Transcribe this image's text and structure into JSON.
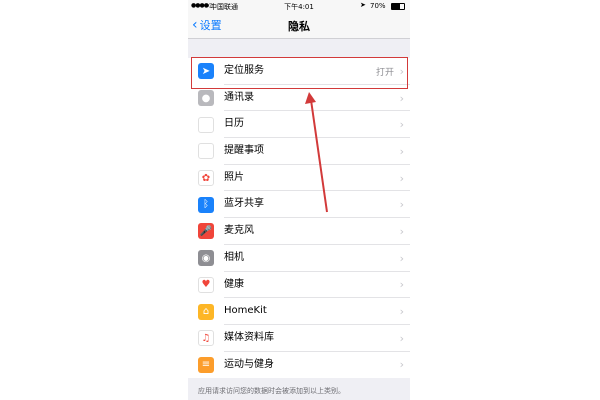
{
  "status_bar": {
    "carrier": "中国联通",
    "time": "下午4:01",
    "battery": "70%"
  },
  "nav": {
    "back_label": "设置",
    "title": "隐私"
  },
  "items": [
    {
      "label": "定位服务",
      "value": "打开",
      "icon": "location-icon",
      "color": "#1a82fb",
      "glyph": "➤"
    },
    {
      "label": "通讯录",
      "value": "",
      "icon": "contacts-icon",
      "color": "#b9b9bd",
      "glyph": "●"
    },
    {
      "label": "日历",
      "value": "",
      "icon": "calendar-icon",
      "color": "#ffffff",
      "glyph": ""
    },
    {
      "label": "提醒事项",
      "value": "",
      "icon": "reminders-icon",
      "color": "#ffffff",
      "glyph": ""
    },
    {
      "label": "照片",
      "value": "",
      "icon": "photos-icon",
      "color": "#ffffff",
      "glyph": "✿"
    },
    {
      "label": "蓝牙共享",
      "value": "",
      "icon": "bluetooth-icon",
      "color": "#1a82fb",
      "glyph": "ᛒ"
    },
    {
      "label": "麦克风",
      "value": "",
      "icon": "microphone-icon",
      "color": "#f0453a",
      "glyph": "🎤"
    },
    {
      "label": "相机",
      "value": "",
      "icon": "camera-icon",
      "color": "#8e8e93",
      "glyph": "◉"
    },
    {
      "label": "健康",
      "value": "",
      "icon": "health-icon",
      "color": "#ffffff",
      "glyph": "♥"
    },
    {
      "label": "HomeKit",
      "value": "",
      "icon": "homekit-icon",
      "color": "#fdb626",
      "glyph": "⌂"
    },
    {
      "label": "媒体资料库",
      "value": "",
      "icon": "media-library-icon",
      "color": "#ffffff",
      "glyph": "♫"
    },
    {
      "label": "运动与健身",
      "value": "",
      "icon": "motion-fitness-icon",
      "color": "#fc9d2b",
      "glyph": "≡"
    }
  ],
  "footer_text": "应用请求访问您的数据时会被添加到以上类别。",
  "annotation_color": "#d23a3a"
}
